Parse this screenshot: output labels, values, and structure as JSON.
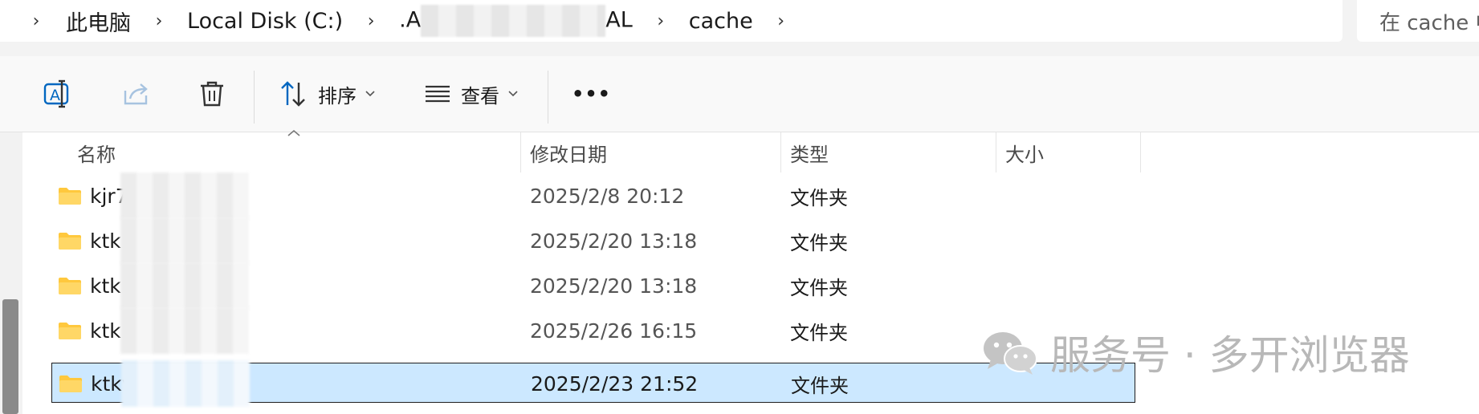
{
  "address_bar": {
    "crumbs": [
      "此电脑",
      "Local Disk (C:)",
      ".A",
      "AL",
      "cache"
    ],
    "search_placeholder": "在 cache 中搜索"
  },
  "toolbar": {
    "sort_label": "排序",
    "view_label": "查看",
    "more_label": "•••"
  },
  "columns": {
    "name": "名称",
    "modified": "修改日期",
    "type": "类型",
    "size": "大小"
  },
  "files": [
    {
      "name": "kjr7",
      "modified": "2025/2/8 20:12",
      "type": "文件夹",
      "size": "",
      "selected": false
    },
    {
      "name": "ktk",
      "modified": "2025/2/20 13:18",
      "type": "文件夹",
      "size": "",
      "selected": false
    },
    {
      "name": "ktk",
      "modified": "2025/2/20 13:18",
      "type": "文件夹",
      "size": "",
      "selected": false
    },
    {
      "name": "ktk",
      "modified": "2025/2/26 16:15",
      "type": "文件夹",
      "size": "",
      "selected": false
    },
    {
      "name": "ktkv",
      "modified": "2025/2/23 21:52",
      "type": "文件夹",
      "size": "",
      "selected": true
    }
  ],
  "watermark": "服务号 · 多开浏览器",
  "colors": {
    "selection_bg": "#cce8ff",
    "folder_yellow": "#ffc83d",
    "accent_blue": "#0067c0"
  }
}
